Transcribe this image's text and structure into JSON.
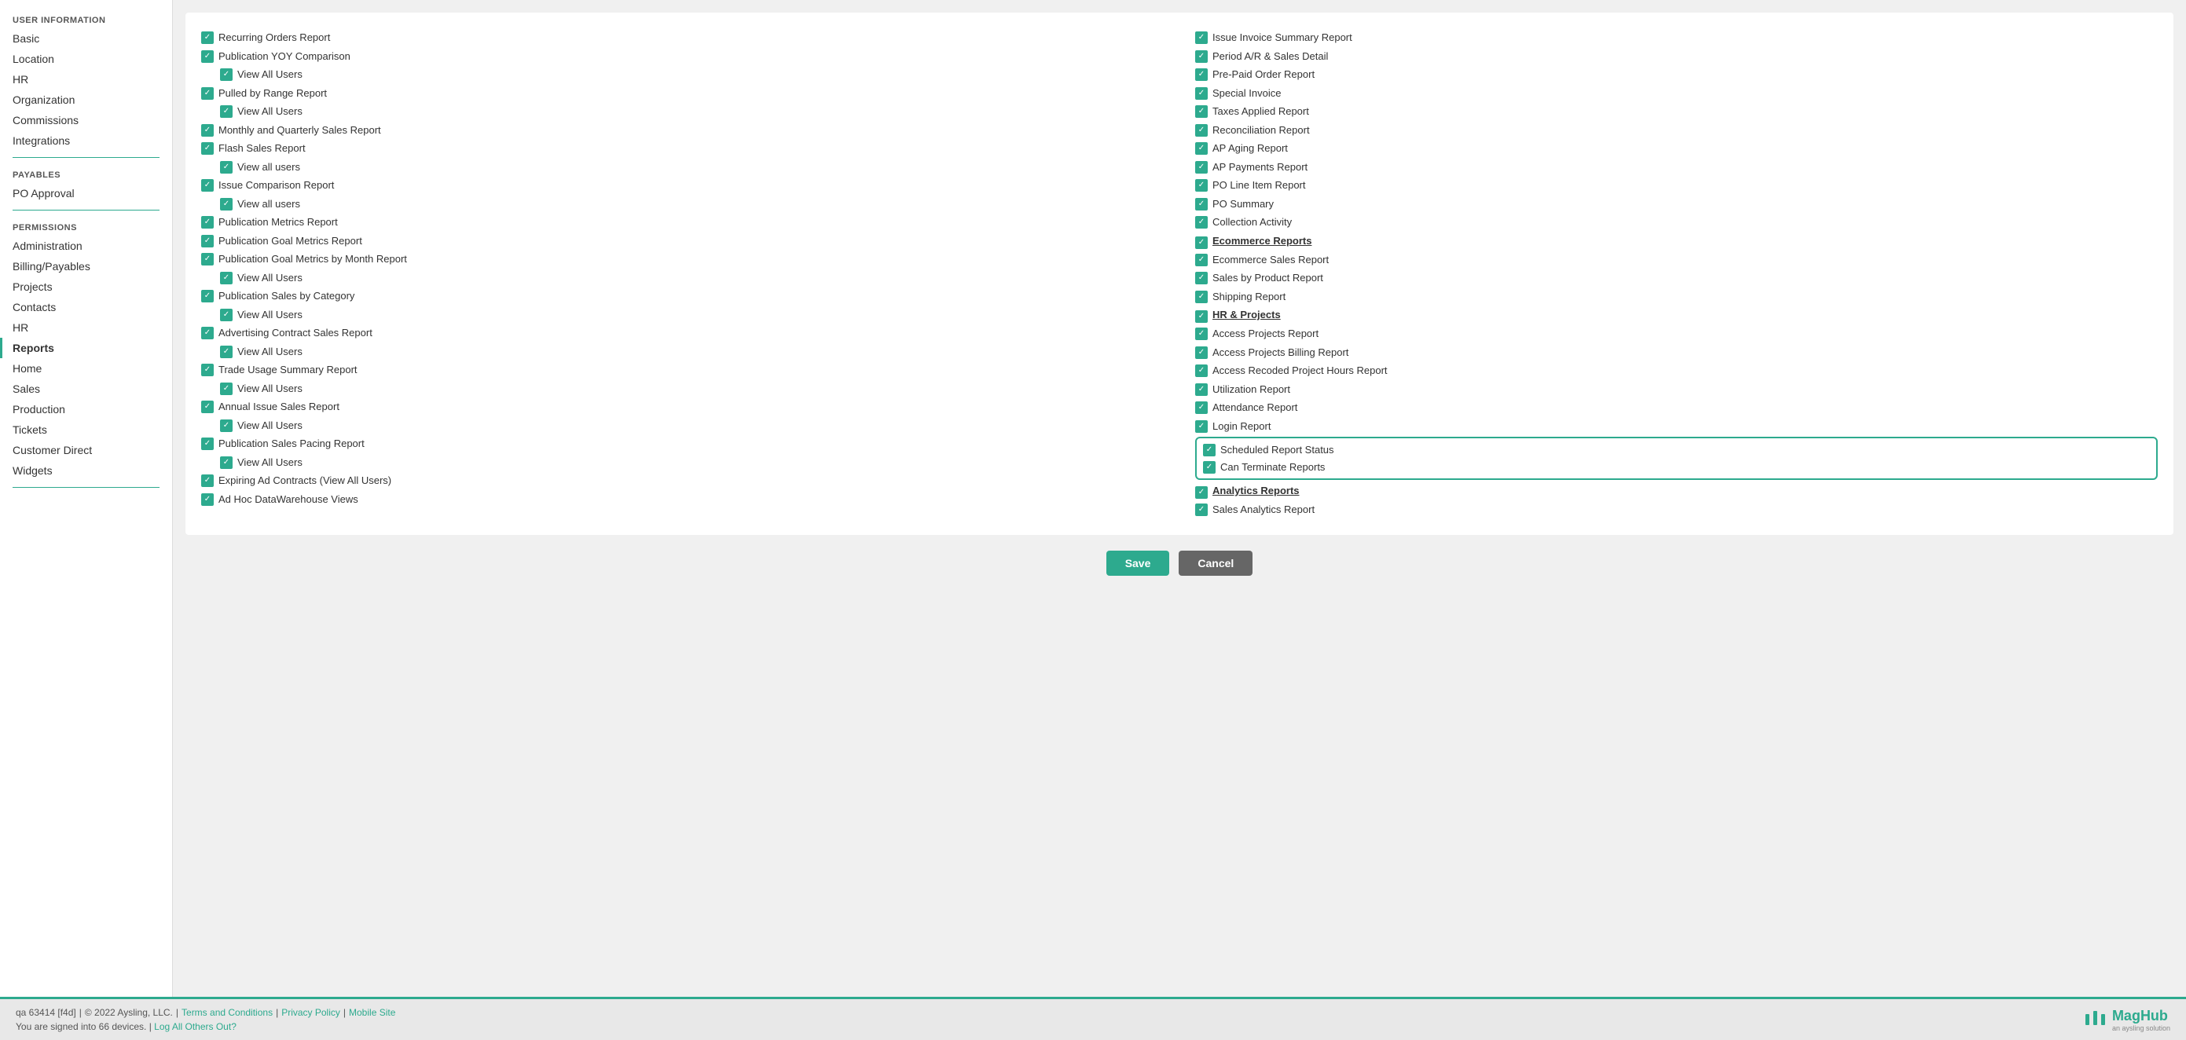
{
  "sidebar": {
    "sections": [
      {
        "title": "USER INFORMATION",
        "items": [
          {
            "label": "Basic",
            "active": false
          },
          {
            "label": "Location",
            "active": false
          },
          {
            "label": "HR",
            "active": false
          },
          {
            "label": "Organization",
            "active": false
          },
          {
            "label": "Commissions",
            "active": false
          },
          {
            "label": "Integrations",
            "active": false
          }
        ]
      },
      {
        "title": "PAYABLES",
        "items": [
          {
            "label": "PO Approval",
            "active": false
          }
        ]
      },
      {
        "title": "PERMISSIONS",
        "items": [
          {
            "label": "Administration",
            "active": false
          },
          {
            "label": "Billing/Payables",
            "active": false
          },
          {
            "label": "Projects",
            "active": false
          },
          {
            "label": "Contacts",
            "active": false
          },
          {
            "label": "HR",
            "active": false
          },
          {
            "label": "Reports",
            "active": true
          },
          {
            "label": "Home",
            "active": false
          },
          {
            "label": "Sales",
            "active": false
          },
          {
            "label": "Production",
            "active": false
          },
          {
            "label": "Tickets",
            "active": false
          },
          {
            "label": "Customer Direct",
            "active": false
          },
          {
            "label": "Widgets",
            "active": false
          }
        ]
      }
    ]
  },
  "left_column": [
    {
      "label": "Recurring Orders Report",
      "indented": false
    },
    {
      "label": "Publication YOY Comparison",
      "indented": false
    },
    {
      "label": "View All Users",
      "indented": true
    },
    {
      "label": "Pulled by Range Report",
      "indented": false
    },
    {
      "label": "View All Users",
      "indented": true
    },
    {
      "label": "Monthly and Quarterly Sales Report",
      "indented": false
    },
    {
      "label": "Flash Sales Report",
      "indented": false
    },
    {
      "label": "View all users",
      "indented": true
    },
    {
      "label": "Issue Comparison Report",
      "indented": false
    },
    {
      "label": "View all users",
      "indented": true
    },
    {
      "label": "Publication Metrics Report",
      "indented": false
    },
    {
      "label": "Publication Goal Metrics Report",
      "indented": false
    },
    {
      "label": "Publication Goal Metrics by Month Report",
      "indented": false
    },
    {
      "label": "View All Users",
      "indented": true
    },
    {
      "label": "Publication Sales by Category",
      "indented": false
    },
    {
      "label": "View All Users",
      "indented": true
    },
    {
      "label": "Advertising Contract Sales Report",
      "indented": false
    },
    {
      "label": "View All Users",
      "indented": true
    },
    {
      "label": "Trade Usage Summary Report",
      "indented": false
    },
    {
      "label": "View All Users",
      "indented": true
    },
    {
      "label": "Annual Issue Sales Report",
      "indented": false
    },
    {
      "label": "View All Users",
      "indented": true
    },
    {
      "label": "Publication Sales Pacing Report",
      "indented": false
    },
    {
      "label": "View All Users",
      "indented": true
    },
    {
      "label": "Expiring Ad Contracts (View All Users)",
      "indented": false
    },
    {
      "label": "Ad Hoc DataWarehouse Views",
      "indented": false
    }
  ],
  "right_column": [
    {
      "label": "Issue Invoice Summary Report",
      "indented": false,
      "type": "item"
    },
    {
      "label": "Period A/R & Sales Detail",
      "indented": false,
      "type": "item"
    },
    {
      "label": "Pre-Paid Order Report",
      "indented": false,
      "type": "item"
    },
    {
      "label": "Special Invoice",
      "indented": false,
      "type": "item"
    },
    {
      "label": "Taxes Applied Report",
      "indented": false,
      "type": "item"
    },
    {
      "label": "Reconciliation Report",
      "indented": false,
      "type": "item"
    },
    {
      "label": "AP Aging Report",
      "indented": false,
      "type": "item"
    },
    {
      "label": "AP Payments Report",
      "indented": false,
      "type": "item"
    },
    {
      "label": "PO Line Item Report",
      "indented": false,
      "type": "item"
    },
    {
      "label": "PO Summary",
      "indented": false,
      "type": "item"
    },
    {
      "label": "Collection Activity",
      "indented": false,
      "type": "item"
    },
    {
      "label": "Ecommerce Reports",
      "indented": false,
      "type": "section-header"
    },
    {
      "label": "Ecommerce Sales Report",
      "indented": false,
      "type": "item"
    },
    {
      "label": "Sales by Product Report",
      "indented": false,
      "type": "item"
    },
    {
      "label": "Shipping Report",
      "indented": false,
      "type": "item"
    },
    {
      "label": "HR & Projects",
      "indented": false,
      "type": "section-header"
    },
    {
      "label": "Access Projects Report",
      "indented": false,
      "type": "item"
    },
    {
      "label": "Access Projects Billing Report",
      "indented": false,
      "type": "item"
    },
    {
      "label": "Access Recoded Project Hours Report",
      "indented": false,
      "type": "item"
    },
    {
      "label": "Utilization Report",
      "indented": false,
      "type": "item"
    },
    {
      "label": "Attendance Report",
      "indented": false,
      "type": "item"
    },
    {
      "label": "Login Report",
      "indented": false,
      "type": "item"
    },
    {
      "label": "Scheduled Report Status",
      "indented": false,
      "type": "highlighted"
    },
    {
      "label": "Can Terminate Reports",
      "indented": true,
      "type": "highlighted-sub"
    },
    {
      "label": "Analytics Reports",
      "indented": false,
      "type": "section-header"
    },
    {
      "label": "Sales Analytics Report",
      "indented": false,
      "type": "item"
    }
  ],
  "buttons": {
    "save": "Save",
    "cancel": "Cancel"
  },
  "footer": {
    "info": "qa 63414 [f4d]",
    "copyright": "© 2022 Aysling, LLC.",
    "terms": "Terms and Conditions",
    "privacy": "Privacy Policy",
    "mobile": "Mobile Site",
    "signed_in": "You are signed into 66 devices.",
    "log_out_link": "Log All Others Out?",
    "brand": "MagHub",
    "brand_sub": "an aysling solution"
  }
}
